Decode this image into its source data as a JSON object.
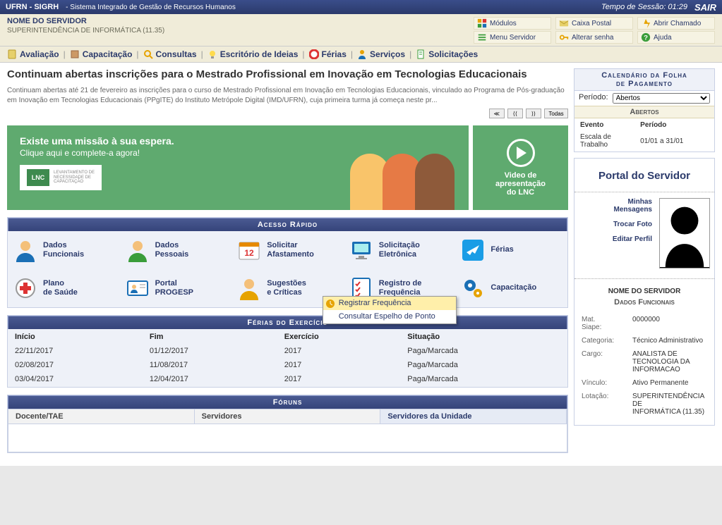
{
  "topbar": {
    "acronym": "UFRN - SIGRH",
    "system_name": "- Sistema Integrado de Gestão de Recursos Humanos",
    "session_label": "Tempo de Sessão:",
    "session_time": "01:29",
    "logout": "SAIR"
  },
  "subbar": {
    "servidor_nome": "NOME DO SERVIDOR",
    "dept": "SUPERINTENDÊNCIA DE INFORMÁTICA (11.35)",
    "links": {
      "modulos": "Módulos",
      "caixa_postal": "Caixa Postal",
      "abrir_chamado": "Abrir Chamado",
      "menu_servidor": "Menu Servidor",
      "alterar_senha": "Alterar senha",
      "ajuda": "Ajuda"
    }
  },
  "menu": {
    "avaliacao": "Avaliação",
    "capacitacao": "Capacitação",
    "consultas": "Consultas",
    "escritorio": "Escritório de Ideias",
    "ferias": "Férias",
    "servicos": "Serviços",
    "solicitacoes": "Solicitações"
  },
  "news": {
    "title": "Continuam abertas inscrições para o Mestrado Profissional em Inovação em Tecnologias Educacionais",
    "body": "Continuam abertas até 21 de fevereiro as inscrições para o curso de Mestrado Profissional em Inovação em Tecnologias Educacionais, vinculado ao Programa de Pós-graduação em Inovação em Tecnologias Educacionais (PPgITE) do Instituto Metrópole Digital (IMD/UFRN), cuja primeira turma já começa neste pr...",
    "btn_first": "≪",
    "btn_prev": "⟨⟨",
    "btn_next": "⟩⟩",
    "btn_all": "Todas"
  },
  "banner": {
    "t1": "Existe uma missão à sua espera.",
    "t2": "Clique aqui e complete-a agora!",
    "lnc_sq": "LNC",
    "lnc_txt": "LEVANTAMENTO DE\nNECESSIDADE DE\nCAPACITAÇÃO",
    "video": "Video de\napresentação\ndo LNC"
  },
  "quick": {
    "header": "Acesso Rápido",
    "items": [
      "Dados\nFuncionais",
      "Dados\nPessoais",
      "Solicitar\nAfastamento",
      "Solicitação\nEletrônica",
      "Férias",
      "Plano\nde Saúde",
      "Portal\nPROGESP",
      "Sugestões\ne Críticas",
      "Registro de\nFrequência",
      "Capacitação"
    ]
  },
  "popup": {
    "registrar": "Registrar Frequência",
    "consultar": "Consultar Espelho de Ponto"
  },
  "ferias": {
    "header": "Férias do Exercício",
    "cols": [
      "Início",
      "Fim",
      "Exercício",
      "Situação"
    ],
    "rows": [
      [
        "22/11/2017",
        "01/12/2017",
        "2017",
        "Paga/Marcada"
      ],
      [
        "02/08/2017",
        "11/08/2017",
        "2017",
        "Paga/Marcada"
      ],
      [
        "03/04/2017",
        "12/04/2017",
        "2017",
        "Paga/Marcada"
      ]
    ]
  },
  "foruns": {
    "header": "Fóruns",
    "tabs": [
      "Docente/TAE",
      "Servidores",
      "Servidores da Unidade"
    ]
  },
  "calendar": {
    "header": "Calendário da Folha\nde Pagamento",
    "periodo_label": "Período:",
    "periodo_value": "Abertos",
    "sub": "Abertos",
    "evento_col": "Evento",
    "periodo_col": "Período",
    "row_evento": "Escala de\nTrabalho",
    "row_periodo": "01/01 a 31/01"
  },
  "portal": {
    "title": "Portal do Servidor",
    "links": {
      "mensagens": "Minhas\nMensagens",
      "foto": "Trocar Foto",
      "perfil": "Editar Perfil"
    },
    "nome": "NOME DO SERVIDOR",
    "dados_title": "Dados Funcionais",
    "fields": {
      "mat_label": "Mat.\nSiape:",
      "mat_value": "0000000",
      "cat_label": "Categoria:",
      "cat_value": "Técnico Administrativo",
      "cargo_label": "Cargo:",
      "cargo_value": "ANALISTA DE\nTECNOLOGIA DA\nINFORMACAO",
      "vinc_label": "Vínculo:",
      "vinc_value": "Ativo Permanente",
      "lot_label": "Lotação:",
      "lot_value": "SUPERINTENDÊNCIA DE\nINFORMÁTICA (11.35)"
    }
  }
}
